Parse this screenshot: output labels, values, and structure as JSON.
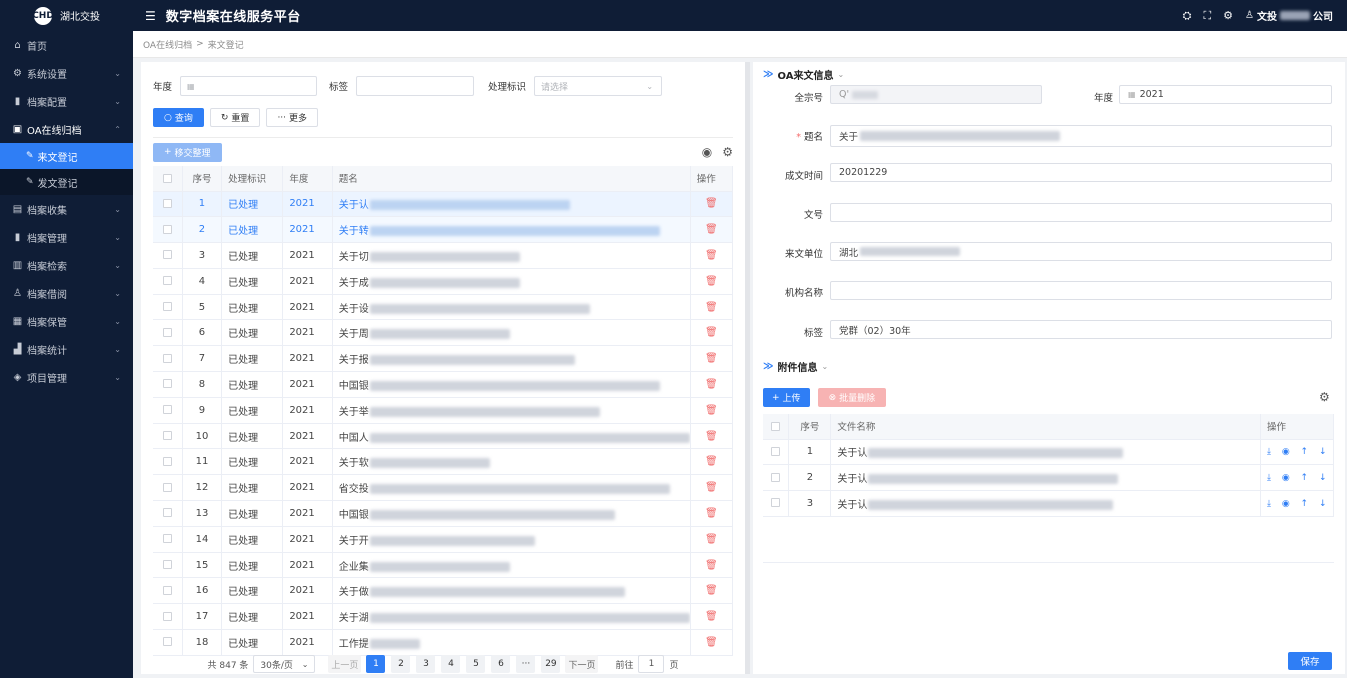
{
  "app": {
    "logo_text": "湖北交投",
    "logo_mark": "CHD",
    "title": "数字档案在线服务平台",
    "user_prefix": "文投",
    "user_suffix": "公司"
  },
  "sidebar": {
    "items": [
      {
        "label": "首页",
        "icon": "home-icon",
        "glyph": "⌂"
      },
      {
        "label": "系统设置",
        "icon": "gear-icon",
        "glyph": "⚙"
      },
      {
        "label": "档案配置",
        "icon": "books-icon",
        "glyph": "▮"
      },
      {
        "label": "OA在线归档",
        "icon": "archive-icon",
        "glyph": "▣"
      },
      {
        "label": "档案收集",
        "icon": "collect-icon",
        "glyph": "▤"
      },
      {
        "label": "档案管理",
        "icon": "books-icon",
        "glyph": "▮"
      },
      {
        "label": "档案检索",
        "icon": "search-book-icon",
        "glyph": "▥"
      },
      {
        "label": "档案借阅",
        "icon": "borrow-icon",
        "glyph": "♙"
      },
      {
        "label": "档案保管",
        "icon": "storage-icon",
        "glyph": "▦"
      },
      {
        "label": "档案统计",
        "icon": "chart-icon",
        "glyph": "▟"
      },
      {
        "label": "项目管理",
        "icon": "layers-icon",
        "glyph": "◈"
      }
    ],
    "sub_items": [
      {
        "label": "来文登记",
        "icon": "edit-icon",
        "glyph": "✎"
      },
      {
        "label": "发文登记",
        "icon": "edit-icon",
        "glyph": "✎"
      }
    ]
  },
  "breadcrumb": {
    "parent": "OA在线归档",
    "sep": ">",
    "current": "来文登记"
  },
  "filters": {
    "year_label": "年度",
    "tag_label": "标签",
    "status_label": "处理标识",
    "status_placeholder": "请选择"
  },
  "buttons": {
    "query": "查询",
    "reset": "重置",
    "more": "更多",
    "transfer": "移交整理"
  },
  "table": {
    "headers": [
      "序号",
      "处理标识",
      "年度",
      "题名",
      "操作"
    ],
    "rows": [
      {
        "no": "1",
        "status": "已处理",
        "year": "2021",
        "title": "关于认"
      },
      {
        "no": "2",
        "status": "已处理",
        "year": "2021",
        "title": "关于转"
      },
      {
        "no": "3",
        "status": "已处理",
        "year": "2021",
        "title": "关于切"
      },
      {
        "no": "4",
        "status": "已处理",
        "year": "2021",
        "title": "关于成"
      },
      {
        "no": "5",
        "status": "已处理",
        "year": "2021",
        "title": "关于设"
      },
      {
        "no": "6",
        "status": "已处理",
        "year": "2021",
        "title": "关于周"
      },
      {
        "no": "7",
        "status": "已处理",
        "year": "2021",
        "title": "关于报"
      },
      {
        "no": "8",
        "status": "已处理",
        "year": "2021",
        "title": "中国银"
      },
      {
        "no": "9",
        "status": "已处理",
        "year": "2021",
        "title": "关于举"
      },
      {
        "no": "10",
        "status": "已处理",
        "year": "2021",
        "title": "中国人"
      },
      {
        "no": "11",
        "status": "已处理",
        "year": "2021",
        "title": "关于软"
      },
      {
        "no": "12",
        "status": "已处理",
        "year": "2021",
        "title": "省交投"
      },
      {
        "no": "13",
        "status": "已处理",
        "year": "2021",
        "title": "中国银"
      },
      {
        "no": "14",
        "status": "已处理",
        "year": "2021",
        "title": "关于开"
      },
      {
        "no": "15",
        "status": "已处理",
        "year": "2021",
        "title": "企业集"
      },
      {
        "no": "16",
        "status": "已处理",
        "year": "2021",
        "title": "关于做"
      },
      {
        "no": "17",
        "status": "已处理",
        "year": "2021",
        "title": "关于湖"
      },
      {
        "no": "18",
        "status": "已处理",
        "year": "2021",
        "title": "工作提"
      }
    ]
  },
  "pager": {
    "total": "共 847 条",
    "page_size": "30条/页",
    "prev": "上一页",
    "pages": [
      "1",
      "2",
      "3",
      "4",
      "5",
      "6",
      "···",
      "29"
    ],
    "next": "下一页",
    "goto_label": "前往",
    "goto_value": "1",
    "goto_unit": "页"
  },
  "oa_info": {
    "section_title": "OA来文信息",
    "fonds_label": "全宗号",
    "fonds_value": "Q'",
    "year_label": "年度",
    "year_value": "2021",
    "title_label": "题名",
    "title_value": "关于",
    "date_label": "成文时间",
    "date_value": "20201229",
    "docno_label": "文号",
    "docno_value": "",
    "unit_label": "来文单位",
    "unit_value": "湖北",
    "org_label": "机构名称",
    "org_value": "",
    "tag_label": "标签",
    "tag_value": "党群（02）30年"
  },
  "attachments": {
    "section_title": "附件信息",
    "upload": "上传",
    "batch_delete": "批量删除",
    "headers": [
      "序号",
      "文件名称",
      "操作"
    ],
    "rows": [
      {
        "no": "1",
        "name": "关于认"
      },
      {
        "no": "2",
        "name": "关于认"
      },
      {
        "no": "3",
        "name": "关于认"
      }
    ],
    "row_ops": "⤓ ◉ ↑ ↓"
  },
  "save": "保存"
}
